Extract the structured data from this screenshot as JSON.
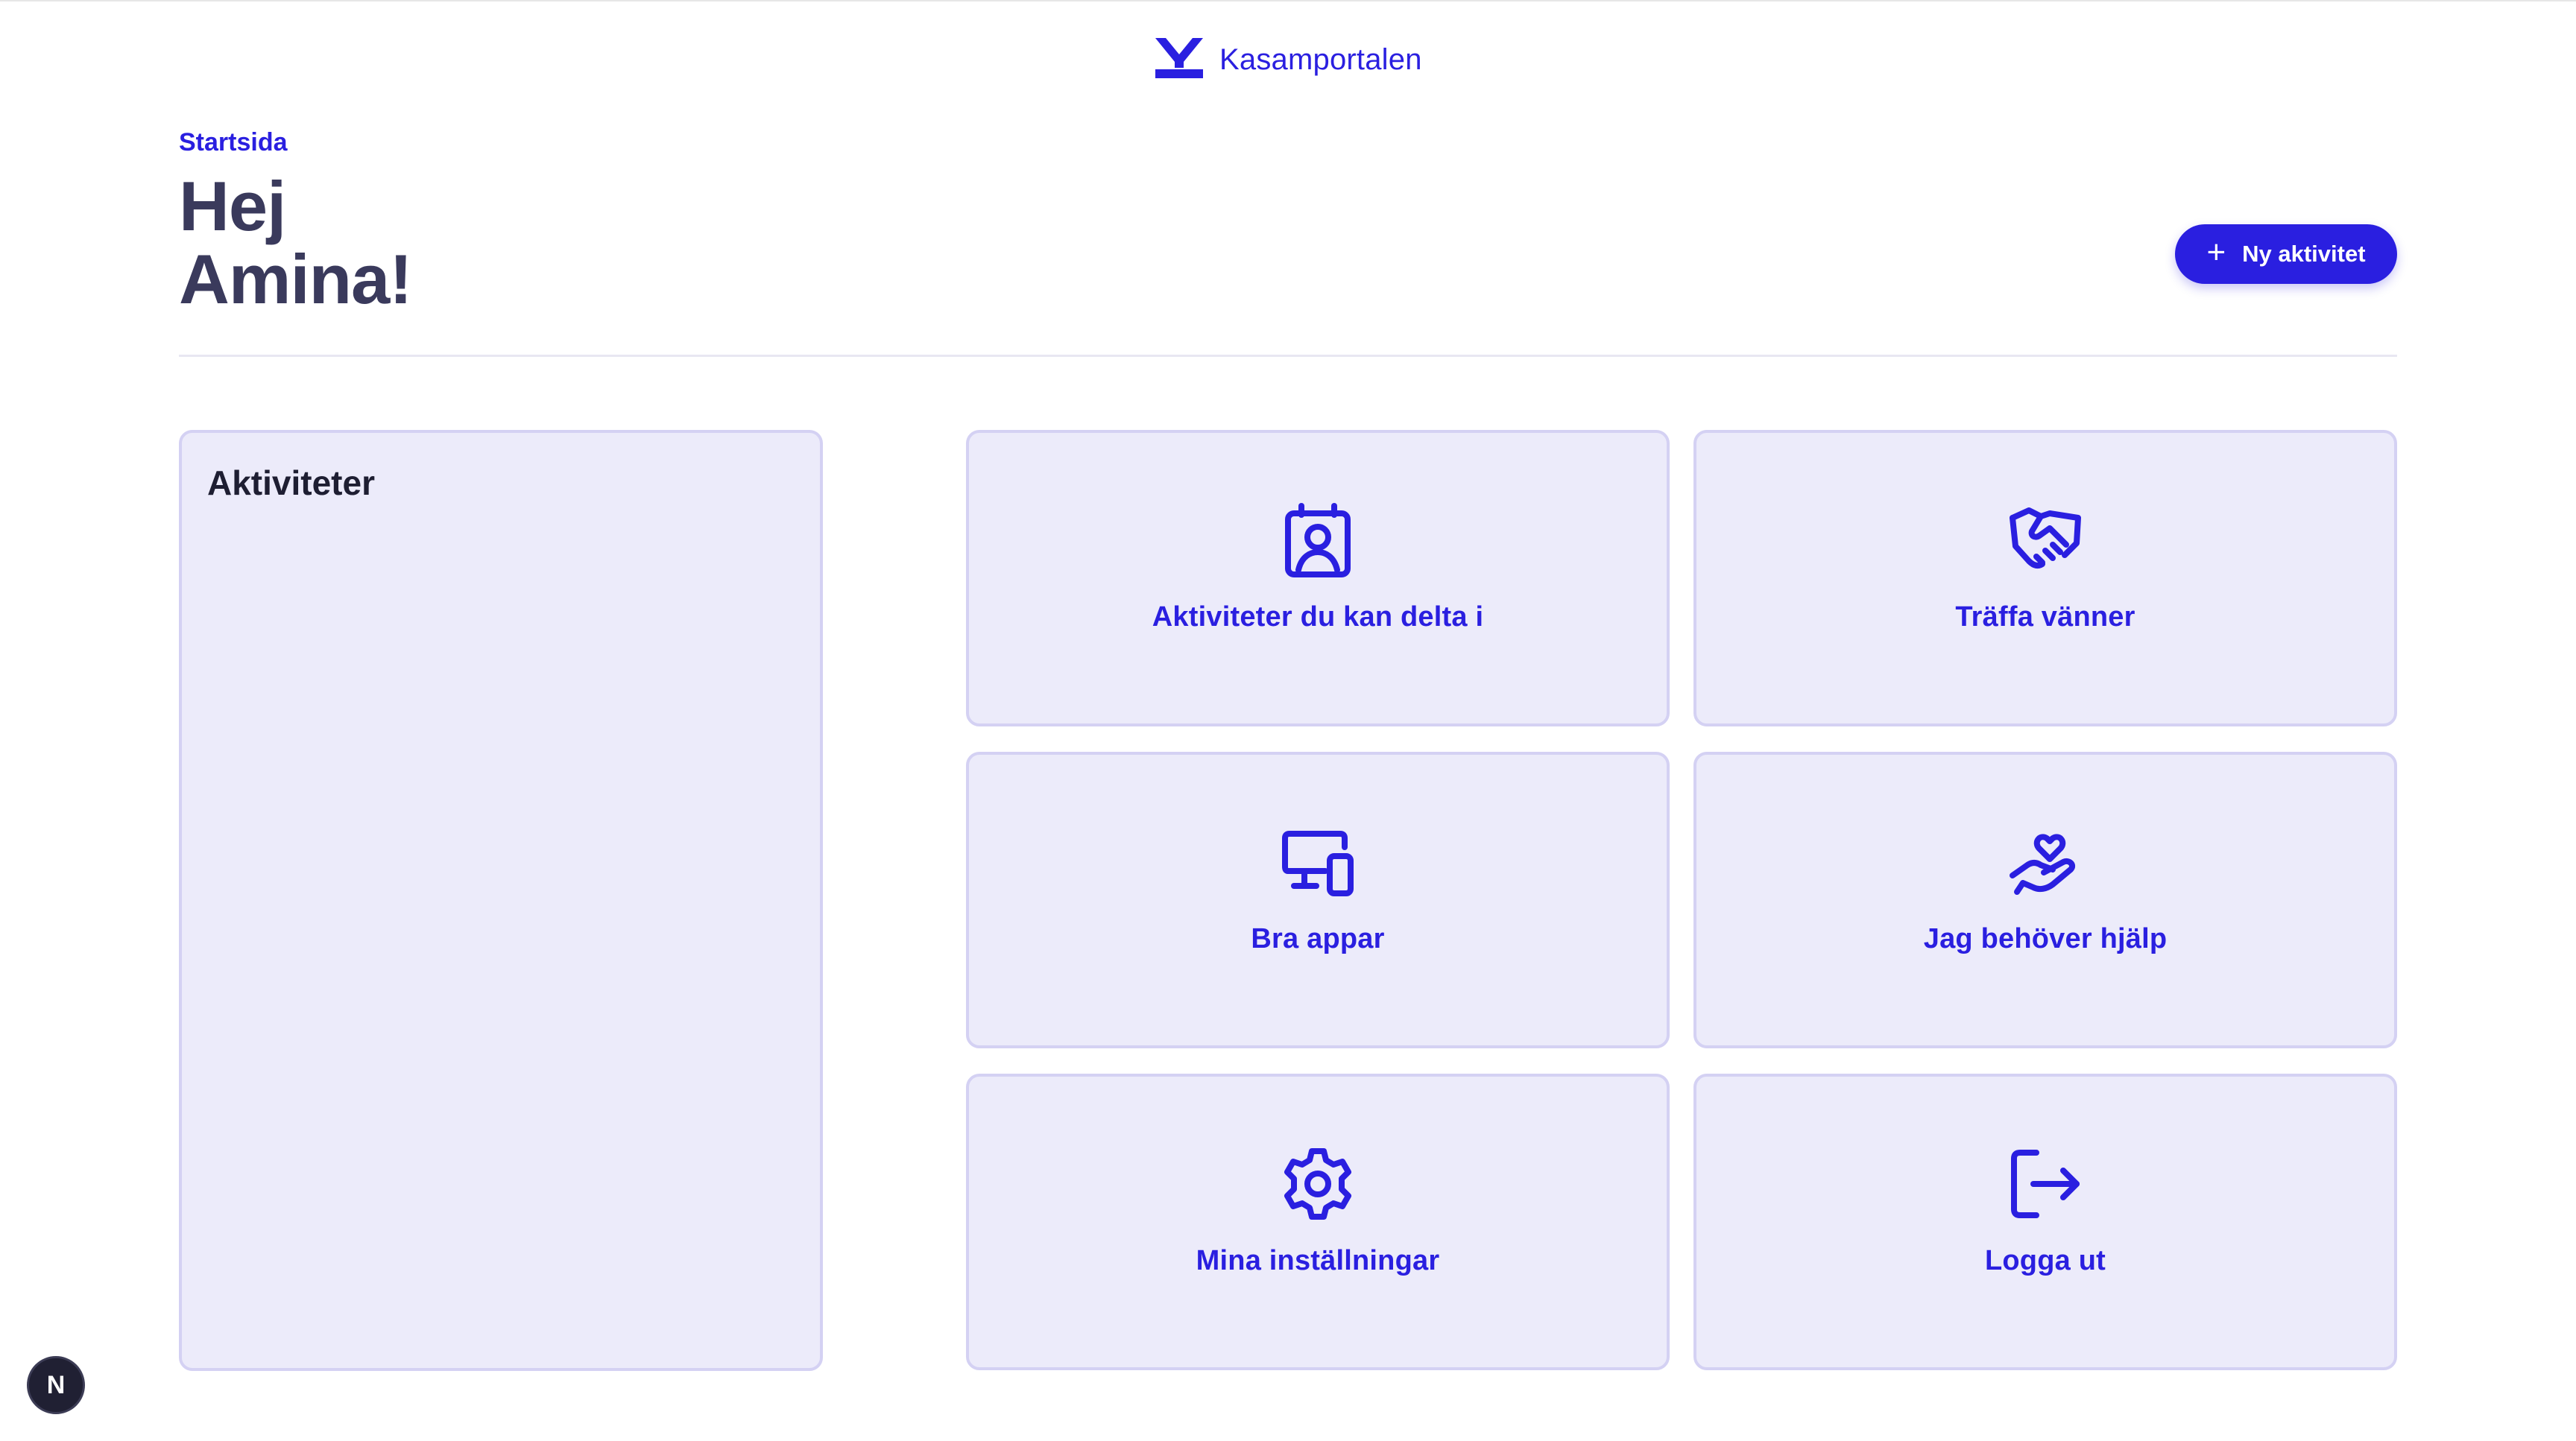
{
  "header": {
    "brand_name": "Kasamportalen",
    "logo_icon": "kasam-logo-icon"
  },
  "main": {
    "breadcrumb": "Startsida",
    "greeting_line1": "Hej",
    "greeting_line2": "Amina!",
    "new_activity_button": "Ny aktivitet"
  },
  "activities_panel": {
    "title": "Aktiviteter"
  },
  "tiles": [
    {
      "label": "Aktiviteter du kan delta i",
      "icon": "calendar-person-icon"
    },
    {
      "label": "Träffa vänner",
      "icon": "handshake-icon"
    },
    {
      "label": "Bra appar",
      "icon": "devices-icon"
    },
    {
      "label": "Jag behöver hjälp",
      "icon": "heart-hand-icon"
    },
    {
      "label": "Mina inställningar",
      "icon": "gear-icon"
    },
    {
      "label": "Logga ut",
      "icon": "logout-icon"
    }
  ],
  "dev_badge": "N",
  "colors": {
    "accent": "#2a1fe0",
    "heading": "#3a3a5c",
    "tile_bg": "#ecebfa",
    "tile_border": "#d4d1f3"
  }
}
